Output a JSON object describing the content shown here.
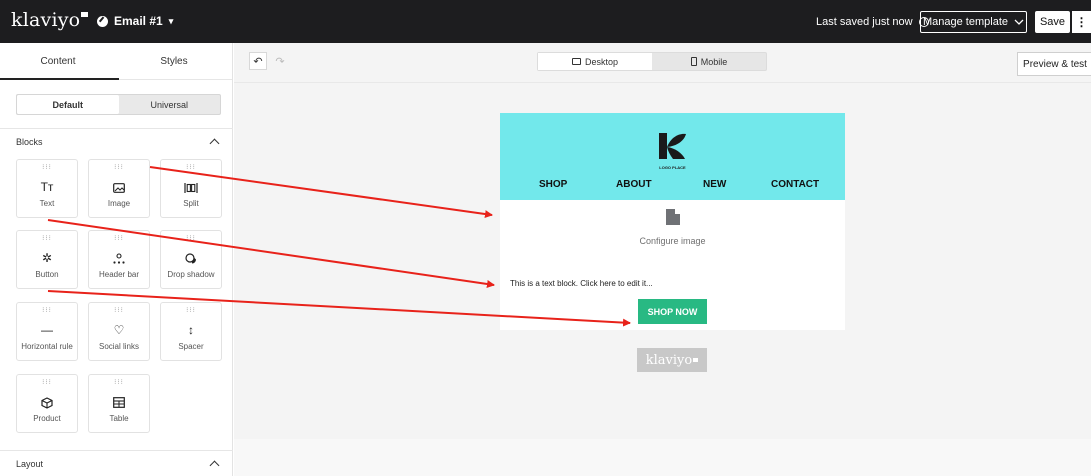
{
  "topbar": {
    "logo": "klaviyo",
    "doc_title": "Email #1",
    "doc_caret": "▾",
    "saved_text": "Last saved just now",
    "manage_label": "Manage template",
    "save_label": "Save",
    "more_label": "⋮"
  },
  "sidebar": {
    "tabs": [
      {
        "label": "Content"
      },
      {
        "label": "Styles"
      }
    ],
    "segment": [
      {
        "label": "Default"
      },
      {
        "label": "Universal"
      }
    ],
    "blocks_title": "Blocks",
    "layout_title": "Layout",
    "blocks": [
      {
        "label": "Text",
        "icon": "text-icon",
        "glyph": "Tт"
      },
      {
        "label": "Image",
        "icon": "image-icon",
        "glyph": "▭"
      },
      {
        "label": "Split",
        "icon": "split-icon",
        "glyph": "|▯▯|"
      },
      {
        "label": "Button",
        "icon": "button-icon",
        "glyph": "✲"
      },
      {
        "label": "Header bar",
        "icon": "header-bar-icon",
        "glyph": "⁖"
      },
      {
        "label": "Drop shadow",
        "icon": "drop-shadow-icon",
        "glyph": "◔"
      },
      {
        "label": "Horizontal rule",
        "icon": "horizontal-rule-icon",
        "glyph": "—"
      },
      {
        "label": "Social links",
        "icon": "heart-icon",
        "glyph": "♡"
      },
      {
        "label": "Spacer",
        "icon": "spacer-icon",
        "glyph": "↕"
      },
      {
        "label": "Product",
        "icon": "product-icon",
        "glyph": "⬡"
      },
      {
        "label": "Table",
        "icon": "table-icon",
        "glyph": "⊞"
      }
    ],
    "grip": "⁝⁝⁝"
  },
  "canvas": {
    "undo": "↶",
    "redo": "↷",
    "devices": [
      {
        "label": "Desktop"
      },
      {
        "label": "Mobile"
      }
    ],
    "preview_label": "Preview & test"
  },
  "email": {
    "header_bg": "#72e8eb",
    "brand_caption": "LOGO PLACE",
    "nav": [
      "SHOP",
      "ABOUT",
      "NEW",
      "CONTACT"
    ],
    "image_placeholder_label": "Configure image",
    "text_block": "This is a text block. Click here to edit it...",
    "button_label": "SHOP NOW",
    "button_color": "#28b983",
    "footer_logo": "klaviyo"
  },
  "annotation_arrow_color": "#e8221a"
}
